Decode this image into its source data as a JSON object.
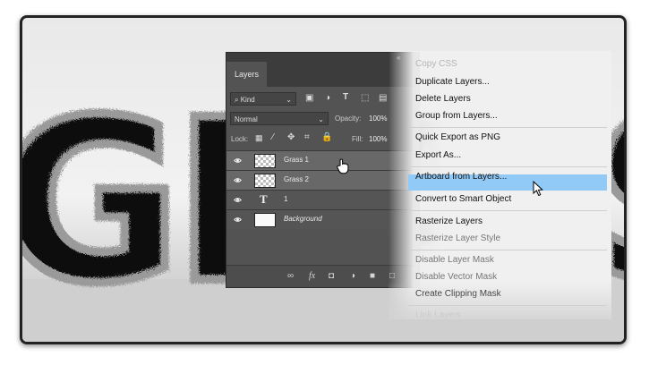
{
  "layers_panel": {
    "tab_label": "Layers",
    "filter": {
      "label": "Kind"
    },
    "blend_mode": "Normal",
    "opacity": {
      "label": "Opacity:",
      "value": "100%"
    },
    "lock": {
      "label": "Lock:"
    },
    "fill": {
      "label": "Fill:",
      "value": "100%"
    },
    "layers": [
      {
        "name": "Grass 1",
        "type": "smart",
        "visible": true,
        "selected": true
      },
      {
        "name": "Grass 2",
        "type": "smart",
        "visible": true,
        "selected": true
      },
      {
        "name": "1",
        "type": "text",
        "visible": true,
        "selected": false
      },
      {
        "name": "Background",
        "type": "background",
        "visible": true,
        "selected": false
      }
    ]
  },
  "context_menu": {
    "items": [
      {
        "label": "Copy CSS",
        "state": "faint"
      },
      {
        "label": "Duplicate Layers...",
        "state": "enabled"
      },
      {
        "label": "Delete Layers",
        "state": "enabled"
      },
      {
        "label": "Group from Layers...",
        "state": "enabled"
      },
      {
        "label": "Quick Export as PNG",
        "state": "enabled"
      },
      {
        "label": "Export As...",
        "state": "enabled"
      },
      {
        "label": "Artboard from Layers...",
        "state": "enabled"
      },
      {
        "label": "Convert to Smart Object",
        "state": "highlighted"
      },
      {
        "label": "Rasterize Layers",
        "state": "enabled"
      },
      {
        "label": "Rasterize Layer Style",
        "state": "disabled"
      },
      {
        "label": "Disable Layer Mask",
        "state": "disabled"
      },
      {
        "label": "Disable Vector Mask",
        "state": "disabled"
      },
      {
        "label": "Create Clipping Mask",
        "state": "enabled"
      },
      {
        "label": "Link Layers",
        "state": "faint"
      }
    ],
    "highlight_color": "#91c9f7"
  },
  "canvas": {
    "artwork_text": "GRA",
    "artwork_text_right": "S"
  }
}
